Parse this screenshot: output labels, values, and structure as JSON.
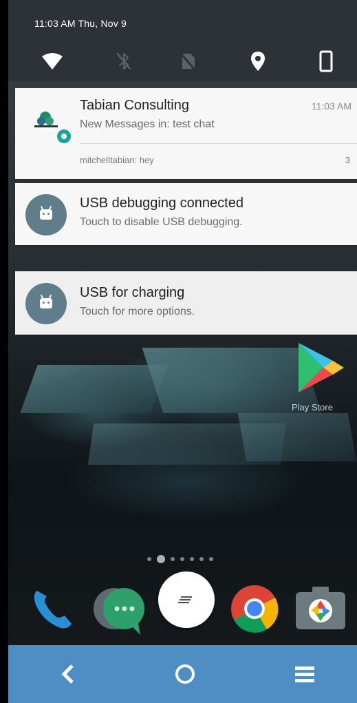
{
  "status_bar": {
    "time_date": "11:03 AM  Thu, Nov 9"
  },
  "quick_settings": {
    "tiles": [
      {
        "icon": "wifi-icon",
        "state": "on"
      },
      {
        "icon": "bluetooth-off-icon",
        "state": "off"
      },
      {
        "icon": "no-sim-icon",
        "state": "off"
      },
      {
        "icon": "location-icon",
        "state": "on"
      },
      {
        "icon": "rotation-portrait-icon",
        "state": "on"
      }
    ]
  },
  "notifications": [
    {
      "app_icon": "tabian-consulting-logo-icon",
      "title": "Tabian Consulting",
      "text": "New Messages in: test chat",
      "time": "11:03 AM",
      "message": "mitchelltabian: hey",
      "count": "3"
    },
    {
      "app_icon": "android-icon",
      "title": "USB debugging connected",
      "text": "Touch to disable USB debugging."
    },
    {
      "app_icon": "android-icon",
      "title": "USB for charging",
      "text": "Touch for more options."
    }
  ],
  "home_screen": {
    "apps": [
      {
        "label": "Play Store",
        "icon": "play-store-icon"
      }
    ],
    "page_count": 7,
    "current_page": 1,
    "dock": [
      {
        "icon": "phone-icon"
      },
      {
        "icon": "messaging-icon"
      },
      {
        "icon": "app-drawer-icon"
      },
      {
        "icon": "chrome-icon"
      },
      {
        "icon": "camera-icon"
      }
    ]
  },
  "nav_bar": {
    "buttons": [
      "back-icon",
      "home-icon",
      "menu-icon"
    ]
  },
  "colors": {
    "quick_settings_bg": "#2d3238",
    "card_bg": "#f7f7f7",
    "android_icon_bg": "#607d8b",
    "nav_bar_bg": "#4f8ec4",
    "tabian_teal": "#1aa39a"
  }
}
